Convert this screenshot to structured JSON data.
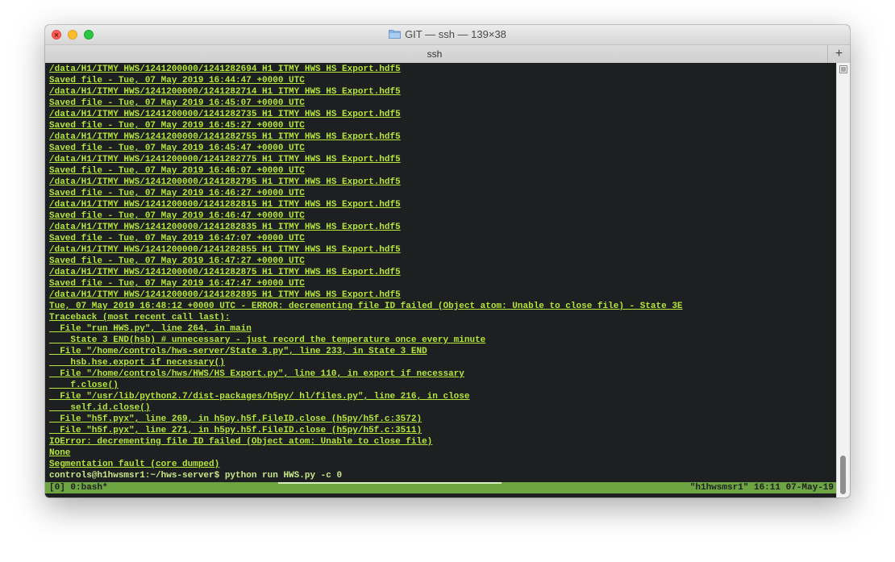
{
  "window": {
    "title": "GIT — ssh — 139×38",
    "tab_label": "ssh",
    "new_tab_label": "+"
  },
  "terminal": {
    "lines": [
      "/data/H1/ITMY HWS/1241200000/1241282694 H1 ITMY HWS HS Export.hdf5",
      "Saved file - Tue, 07 May 2019 16:44:47 +0000 UTC",
      "/data/H1/ITMY HWS/1241200000/1241282714 H1 ITMY HWS HS Export.hdf5",
      "Saved file - Tue, 07 May 2019 16:45:07 +0000 UTC",
      "/data/H1/ITMY HWS/1241200000/1241282735 H1 ITMY HWS HS Export.hdf5",
      "Saved file - Tue, 07 May 2019 16:45:27 +0000 UTC",
      "/data/H1/ITMY HWS/1241200000/1241282755 H1 ITMY HWS HS Export.hdf5",
      "Saved file - Tue, 07 May 2019 16:45:47 +0000 UTC",
      "/data/H1/ITMY HWS/1241200000/1241282775 H1 ITMY HWS HS Export.hdf5",
      "Saved file - Tue, 07 May 2019 16:46:07 +0000 UTC",
      "/data/H1/ITMY HWS/1241200000/1241282795 H1 ITMY HWS HS Export.hdf5",
      "Saved file - Tue, 07 May 2019 16:46:27 +0000 UTC",
      "/data/H1/ITMY HWS/1241200000/1241282815 H1 ITMY HWS HS Export.hdf5",
      "Saved file - Tue, 07 May 2019 16:46:47 +0000 UTC",
      "/data/H1/ITMY HWS/1241200000/1241282835 H1 ITMY HWS HS Export.hdf5",
      "Saved file - Tue, 07 May 2019 16:47:07 +0000 UTC",
      "/data/H1/ITMY HWS/1241200000/1241282855 H1 ITMY HWS HS Export.hdf5",
      "Saved file - Tue, 07 May 2019 16:47:27 +0000 UTC",
      "/data/H1/ITMY HWS/1241200000/1241282875 H1 ITMY HWS HS Export.hdf5",
      "Saved file - Tue, 07 May 2019 16:47:47 +0000 UTC",
      "/data/H1/ITMY HWS/1241200000/1241282895 H1 ITMY HWS HS Export.hdf5",
      "Tue, 07 May 2019 16:48:12 +0000 UTC - ERROR: decrementing file ID failed (Object atom: Unable to close file) - State 3E",
      "Traceback (most recent call last):",
      "  File \"run HWS.py\", line 264, in main",
      "    State 3 END(hsb) # unnecessary - just record the temperature once every minute",
      "  File \"/home/controls/hws-server/State 3.py\", line 233, in State 3 END",
      "    hsb.hse.export if necessary()",
      "  File \"/home/controls/hws/HWS/HS Export.py\", line 110, in export if necessary",
      "    f.close()",
      "  File \"/usr/lib/python2.7/dist-packages/h5py/ hl/files.py\", line 216, in close",
      "    self.id.close()",
      "  File \"h5f.pyx\", line 269, in h5py.h5f.FileID.close (h5py/h5f.c:3572)",
      "  File \"h5f.pyx\", line 271, in h5py.h5f.FileID.close (h5py/h5f.c:3511)",
      "IOError: decrementing file ID failed (Object atom: Unable to close file)",
      "None",
      "Segmentation fault (core dumped)"
    ],
    "prompt": "controls@h1hwsmsr1:~/hws-server$",
    "command": " python run HWS.py -c 0"
  },
  "statusbar": {
    "left": "[0] 0:bash*",
    "right": "\"h1hwsmsr1\" 16:11 07-May-19"
  },
  "colors": {
    "terminal_text": "#b5e83a",
    "terminal_bg": "#1d1f21",
    "status_bg": "#6da542"
  },
  "icons": {
    "folder": "folder-icon",
    "close": "close-icon",
    "minimize": "minimize-icon",
    "maximize": "maximize-icon",
    "scroll_menu": "hamburger-icon"
  }
}
